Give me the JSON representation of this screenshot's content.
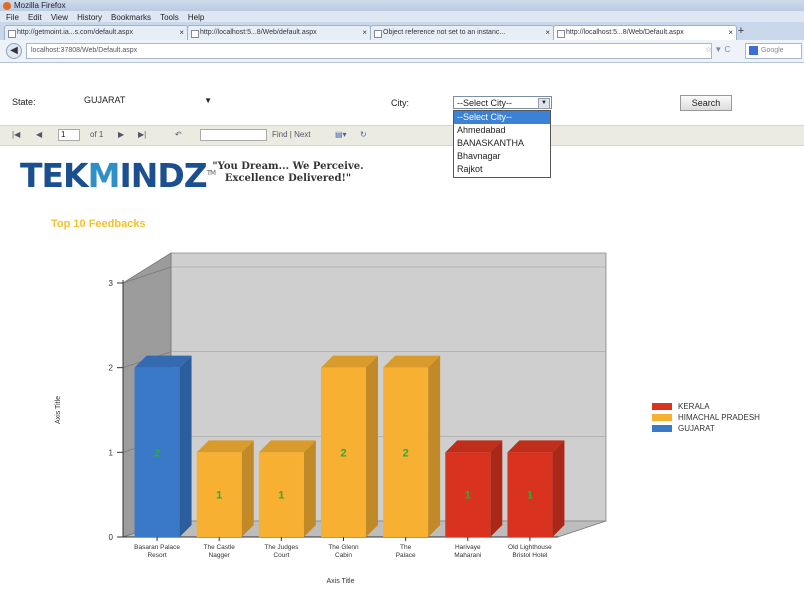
{
  "browser": {
    "title": "Mozilla Firefox",
    "menu": [
      "File",
      "Edit",
      "View",
      "History",
      "Bookmarks",
      "Tools",
      "Help"
    ],
    "tabs": [
      {
        "label": "http://getmoint.ia...s.com/default.aspx",
        "active": false
      },
      {
        "label": "http://localhost:5...8/Web/default.aspx",
        "active": false
      },
      {
        "label": "Object reference not set to an instanc...",
        "active": false
      },
      {
        "label": "http://localhost:5...8/Web/Default.aspx",
        "active": true
      }
    ],
    "new_tab_label": "+",
    "url": "localhost:37808/Web/Default.aspx",
    "search_engine": "Google"
  },
  "filters": {
    "state_label": "State:",
    "state_value": "GUJARAT",
    "city_label": "City:",
    "city_value": "--Select City--",
    "city_options": [
      "--Select City--",
      "Ahmedabad",
      "BANASKANTHA",
      "Bhavnagar",
      "Rajkot"
    ],
    "search_button": "Search"
  },
  "report_toolbar": {
    "page_current": "1",
    "page_of": "of 1",
    "find_label": "Find | Next"
  },
  "brand": {
    "logo_pre": "TEK",
    "logo_mid": "M",
    "logo_post": "INDZ",
    "tm": "TM",
    "tagline": "\"You Dream... We Perceive. Excellence Delivered!\""
  },
  "chart_data": {
    "type": "bar",
    "title": "Top 10 Feedbacks",
    "xlabel": "Axis Title",
    "ylabel": "Axis Title",
    "ylim": [
      0,
      3
    ],
    "yticks": [
      0,
      1,
      2,
      3
    ],
    "categories": [
      "Basaran Palace Resort",
      "The Castle Nagger",
      "The Judges Court",
      "The Glenn Cabin",
      "The Palace",
      "Harivaye Maharani",
      "Old Lighthouse Bristol Hotel"
    ],
    "series": [
      {
        "name": "KERALA",
        "color": "#d9331f",
        "values": [
          null,
          null,
          null,
          null,
          null,
          1,
          1
        ]
      },
      {
        "name": "HIMACHAL PRADESH",
        "color": "#f7b032",
        "values": [
          null,
          1,
          1,
          2,
          2,
          null,
          null
        ]
      },
      {
        "name": "GUJARAT",
        "color": "#3a78c8",
        "values": [
          2,
          null,
          null,
          null,
          null,
          null,
          null
        ]
      }
    ],
    "legend_position": "right",
    "label_color": "#2faa3c"
  }
}
